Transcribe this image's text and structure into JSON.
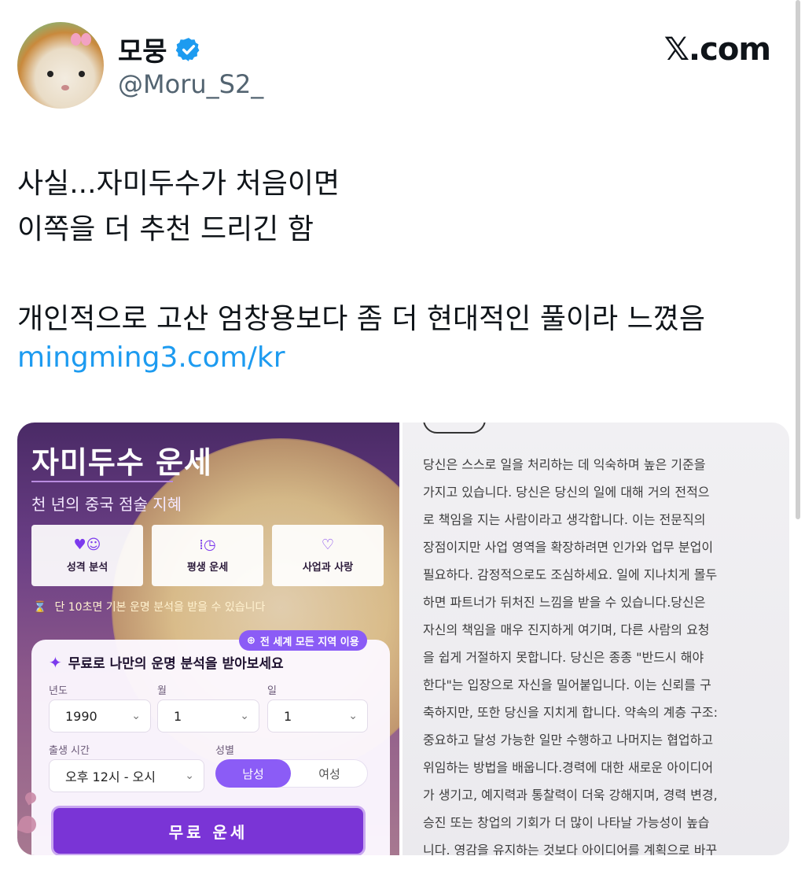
{
  "author": {
    "display_name": "모뭉",
    "handle": "@Moru_S2_",
    "verified_icon": "verified-badge-icon"
  },
  "source": "𝕏.com",
  "tweet": {
    "lines": [
      "사실...자미두수가 처음이면",
      "이쪽을 더 추천 드리긴 함",
      "개인적으로 고산 엄창용보다 좀 더 현대적인 풀이라 느꼈음"
    ],
    "link": "mingming3.com/kr"
  },
  "left_image": {
    "title": "자미두수 운세",
    "subtitle": "천 년의 중국 점술 지혜",
    "features": [
      {
        "icon": "people-heart-icon",
        "label": "성격 분석"
      },
      {
        "icon": "timeline-clock-icon",
        "label": "평생 운세"
      },
      {
        "icon": "heart-icon",
        "label": "사업과 사랑"
      }
    ],
    "hint": "단 10초면 기본 운명 분석을 받을 수 있습니다",
    "world_badge": "전 세계 모든 지역 이용",
    "form_title": "무료로 나만의 운명 분석을 받아보세요",
    "year_label": "년도",
    "year_value": "1990",
    "month_label": "월",
    "month_value": "1",
    "day_label": "일",
    "day_value": "1",
    "time_label": "출생 시간",
    "time_value": "오후 12시 - 오시",
    "gender_label": "성별",
    "gender_male": "남성",
    "gender_female": "여성",
    "cta": "무료 운세"
  },
  "right_image": {
    "lines": [
      "당신은 스스로 일을 처리하는 데 익숙하며 높은 기준을",
      "가지고 있습니다. 당신은 당신의 일에 대해 거의 전적으",
      "로 책임을 지는 사람이라고 생각합니다. 이는 전문직의",
      "장점이지만 사업 영역을 확장하려면 인가와 업무 분업이",
      "필요하다. 감정적으로도 조심하세요. 일에 지나치게 몰두",
      "하면 파트너가 뒤처진 느낌을 받을 수 있습니다.당신은",
      "자신의 책임을 매우 진지하게 여기며, 다른 사람의 요청",
      "을 쉽게 거절하지 못합니다. 당신은 종종 \"반드시 해야",
      "한다\"는 입장으로 자신을 밀어붙입니다. 이는 신뢰를 구",
      "축하지만, 또한 당신을 지치게 합니다. 약속의 계층 구조:",
      "중요하고 달성 가능한 일만 수행하고 나머지는 협업하고",
      "위임하는 방법을 배웁니다.경력에 대한 새로운 아이디어",
      "가 생기고, 예지력과 통찰력이 더욱 강해지며, 경력 변경,",
      "승진 또는 창업의 기회가 더 많이 나타날 가능성이 높습",
      "니다. 영감을 유지하는 것보다 아이디어를 계획으로 바꾸"
    ]
  },
  "colors": {
    "link": "#1d9bf0",
    "verified": "#1d9bf0",
    "accent_purple": "#7a34d6"
  }
}
